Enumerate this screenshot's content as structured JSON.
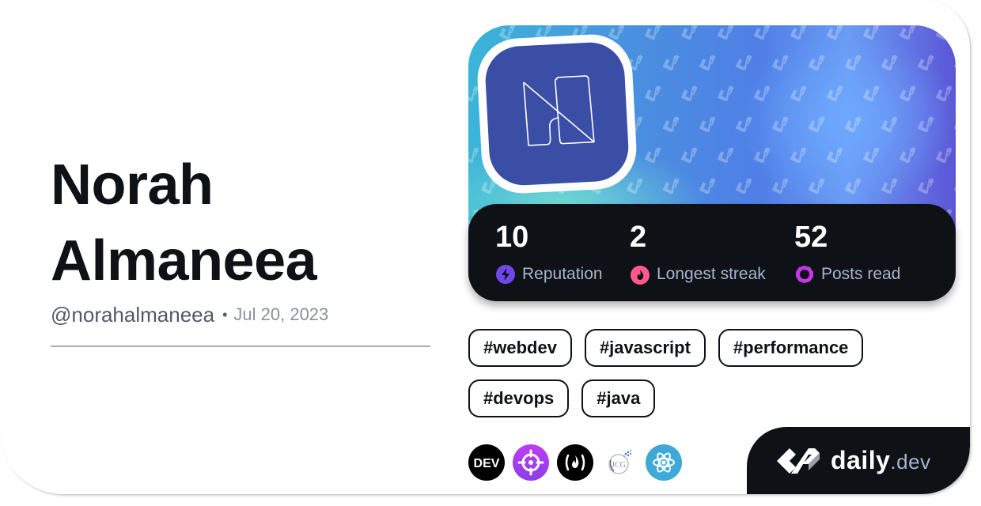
{
  "profile": {
    "first_name": "Norah",
    "last_name": "Almaneea",
    "username": "@norahalmaneea",
    "separator": "•",
    "joined": "Jul 20, 2023",
    "avatar_icon": "monogram-n-logo"
  },
  "stats": [
    {
      "value": "10",
      "label": "Reputation",
      "icon": "lightning-icon",
      "color": "#7147ed"
    },
    {
      "value": "2",
      "label": "Longest streak",
      "icon": "flame-icon",
      "color": "#ff5a8a"
    },
    {
      "value": "52",
      "label": "Posts read",
      "icon": "ring-icon",
      "color": "#c735e8"
    }
  ],
  "tags": [
    [
      "#webdev",
      "#javascript",
      "#performance"
    ],
    [
      "#devops",
      "#java"
    ]
  ],
  "sources": [
    {
      "name": "dev-to",
      "label": "DEV",
      "bg": "#000000"
    },
    {
      "name": "crosshair-source",
      "label": "",
      "bg": "#9d3cf0"
    },
    {
      "name": "freecodecamp",
      "label": "(🔥)",
      "bg": "#000000"
    },
    {
      "name": "jcg",
      "label": "JCG",
      "bg": "#ffffff"
    },
    {
      "name": "react",
      "label": "",
      "bg": "#3ea9d6"
    }
  ],
  "brand": {
    "name": "daily",
    "tld": ".dev"
  },
  "colors": {
    "dark": "#0e1217",
    "muted": "#a8b3cf",
    "avatar_bg": "#3a4ea5"
  }
}
